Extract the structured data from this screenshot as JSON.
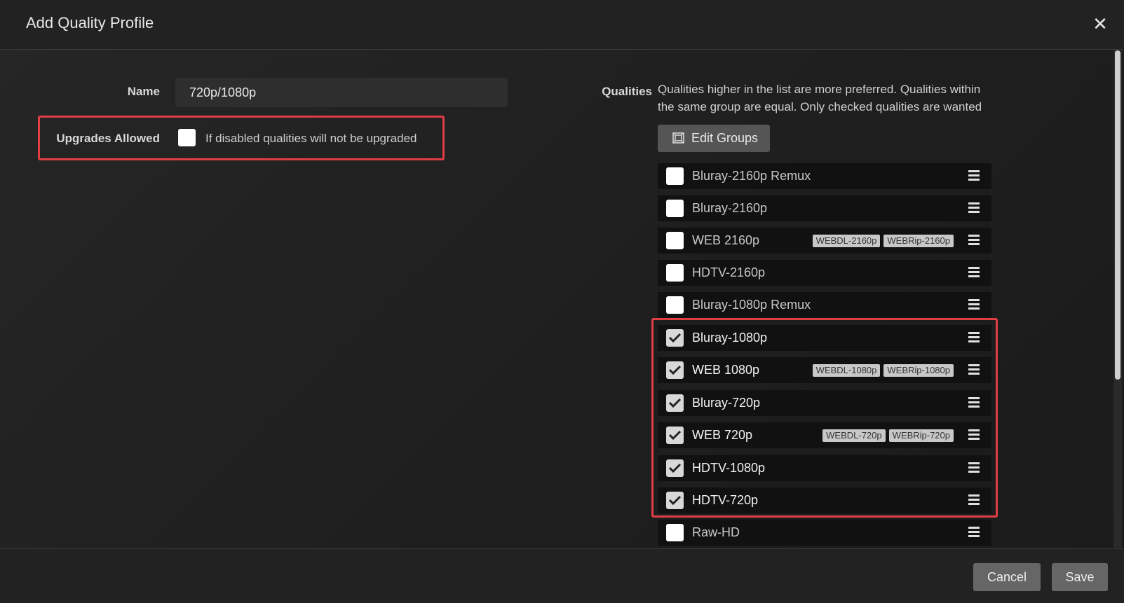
{
  "modal": {
    "title": "Add Quality Profile"
  },
  "form": {
    "name_label": "Name",
    "name_value": "720p/1080p",
    "upgrades_label": "Upgrades Allowed",
    "upgrades_help": "If disabled qualities will not be upgraded",
    "upgrades_checked": false,
    "qualities_label": "Qualities",
    "qualities_help": "Qualities higher in the list are more preferred. Qualities within the same group are equal. Only checked qualities are wanted",
    "edit_groups_label": "Edit Groups"
  },
  "qualities": [
    {
      "name": "Bluray-2160p Remux",
      "checked": false,
      "tags": []
    },
    {
      "name": "Bluray-2160p",
      "checked": false,
      "tags": []
    },
    {
      "name": "WEB 2160p",
      "checked": false,
      "tags": [
        "WEBDL-2160p",
        "WEBRip-2160p"
      ]
    },
    {
      "name": "HDTV-2160p",
      "checked": false,
      "tags": []
    },
    {
      "name": "Bluray-1080p Remux",
      "checked": false,
      "tags": []
    },
    {
      "name": "Bluray-1080p",
      "checked": true,
      "tags": []
    },
    {
      "name": "WEB 1080p",
      "checked": true,
      "tags": [
        "WEBDL-1080p",
        "WEBRip-1080p"
      ]
    },
    {
      "name": "Bluray-720p",
      "checked": true,
      "tags": []
    },
    {
      "name": "WEB 720p",
      "checked": true,
      "tags": [
        "WEBDL-720p",
        "WEBRip-720p"
      ]
    },
    {
      "name": "HDTV-1080p",
      "checked": true,
      "tags": []
    },
    {
      "name": "HDTV-720p",
      "checked": true,
      "tags": []
    },
    {
      "name": "Raw-HD",
      "checked": false,
      "tags": []
    }
  ],
  "footer": {
    "cancel_label": "Cancel",
    "save_label": "Save"
  },
  "colors": {
    "highlight": "#e03d45",
    "background": "#1e1e1e",
    "button": "#666666"
  }
}
